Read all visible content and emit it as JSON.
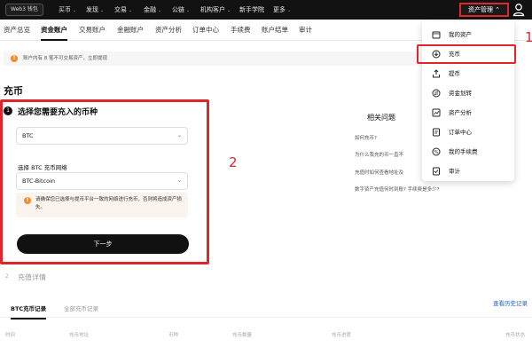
{
  "topnav": {
    "brand": "Web3 钱包",
    "items": [
      {
        "label": "买币",
        "chev": "⌄"
      },
      {
        "label": "发现",
        "chev": "⌄"
      },
      {
        "label": "交易",
        "chev": "⌄"
      },
      {
        "label": "金融",
        "chev": "⌄"
      },
      {
        "label": "公链",
        "chev": "⌄"
      },
      {
        "label": "机构客户",
        "chev": "⌄"
      },
      {
        "label": "新手学院",
        "chev": ""
      },
      {
        "label": "更多",
        "chev": "⌄"
      }
    ],
    "asset_button": "资产管理 ⌃",
    "user_icon": "user-icon"
  },
  "subnav": {
    "tabs": [
      "资产总览",
      "资金账户",
      "交易账户",
      "金融账户",
      "资产分析",
      "订单中心",
      "手续费",
      "账户结单",
      "审计"
    ],
    "active": 1
  },
  "notice": {
    "text": "账户内有 8 笔不可交易资产，立即提现"
  },
  "page_title": "充币",
  "step1": {
    "num": "1",
    "title": "选择您需要充入的币种",
    "coin_value": "BTC",
    "network_label": "选择 BTC 充币网络",
    "network_value": "BTC-Bitcoin",
    "warning": "请确保您已选择与提币平台一致的网络进行充币，否则将造成资产损失。",
    "next_button": "下一步"
  },
  "step2": {
    "num": "2",
    "title": "充值详情"
  },
  "annotations": {
    "one": "1",
    "two": "2"
  },
  "related": {
    "title": "相关问题",
    "items": [
      "如何充币?",
      "为什么我充的币一直不",
      "充值时如何查看地址及",
      "数字资产充值何时到账? 手续费是多少?"
    ]
  },
  "records": {
    "tabs": [
      "BTC充币记录",
      "全部充币记录"
    ],
    "history_link": "查看历史记录",
    "columns": [
      "时间",
      "充币地址",
      "币种",
      "充币数量",
      "充币进度",
      "充币状态"
    ]
  },
  "menu": {
    "items": [
      {
        "label": "我的资产",
        "icon": "wallet-icon"
      },
      {
        "label": "充币",
        "icon": "deposit-icon"
      },
      {
        "label": "提币",
        "icon": "withdraw-icon"
      },
      {
        "label": "资金划转",
        "icon": "transfer-icon"
      },
      {
        "label": "资产分析",
        "icon": "analysis-icon"
      },
      {
        "label": "订单中心",
        "icon": "order-icon"
      },
      {
        "label": "我的手续费",
        "icon": "fee-icon"
      },
      {
        "label": "审计",
        "icon": "audit-icon"
      }
    ],
    "highlighted": 1
  },
  "colors": {
    "annotation_red": "#e0262d",
    "warning_orange": "#f18b2a",
    "link_blue": "#1b5fd6",
    "topbar": "#121212"
  }
}
